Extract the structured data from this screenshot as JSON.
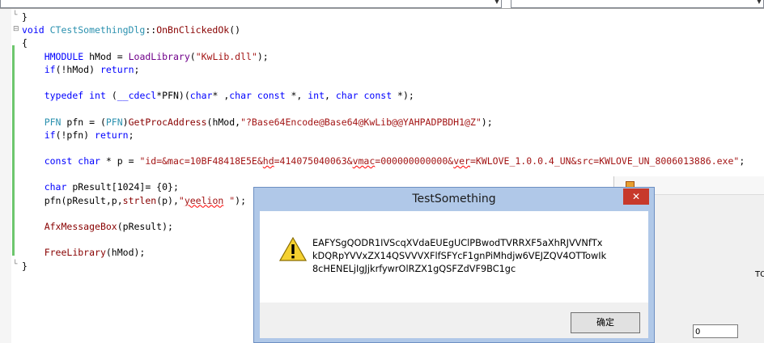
{
  "editor": {
    "lines": [
      {
        "segs": [
          {
            "t": "}",
            "c": ""
          }
        ]
      },
      {
        "segs": [
          {
            "t": "void ",
            "c": "kw"
          },
          {
            "t": "CTestSomethingDlg",
            "c": "cls"
          },
          {
            "t": "::",
            "c": ""
          },
          {
            "t": "OnBnClickedOk",
            "c": "fn"
          },
          {
            "t": "()",
            "c": ""
          }
        ]
      },
      {
        "segs": [
          {
            "t": "{",
            "c": ""
          }
        ]
      },
      {
        "segs": [
          {
            "t": "    ",
            "c": ""
          },
          {
            "t": "HMODULE",
            "c": "ty"
          },
          {
            "t": " ",
            "c": ""
          },
          {
            "t": "hMod",
            "c": ""
          },
          {
            "t": " = ",
            "c": ""
          },
          {
            "t": "LoadLibrary",
            "c": "mac"
          },
          {
            "t": "(",
            "c": ""
          },
          {
            "t": "\"KwLib.dll\"",
            "c": "str"
          },
          {
            "t": ");",
            "c": ""
          }
        ]
      },
      {
        "segs": [
          {
            "t": "    ",
            "c": ""
          },
          {
            "t": "if",
            "c": "kw"
          },
          {
            "t": "(!hMod) ",
            "c": ""
          },
          {
            "t": "return",
            "c": "kw"
          },
          {
            "t": ";",
            "c": ""
          }
        ]
      },
      {
        "segs": [
          {
            "t": "",
            "c": ""
          }
        ]
      },
      {
        "segs": [
          {
            "t": "    ",
            "c": ""
          },
          {
            "t": "typedef",
            "c": "kw"
          },
          {
            "t": " ",
            "c": ""
          },
          {
            "t": "int",
            "c": "kw"
          },
          {
            "t": " (",
            "c": ""
          },
          {
            "t": "__cdecl",
            "c": "kw"
          },
          {
            "t": "*PFN)(",
            "c": ""
          },
          {
            "t": "char",
            "c": "kw"
          },
          {
            "t": "* ,",
            "c": ""
          },
          {
            "t": "char",
            "c": "kw"
          },
          {
            "t": " ",
            "c": ""
          },
          {
            "t": "const",
            "c": "kw"
          },
          {
            "t": " *, ",
            "c": ""
          },
          {
            "t": "int",
            "c": "kw"
          },
          {
            "t": ", ",
            "c": ""
          },
          {
            "t": "char",
            "c": "kw"
          },
          {
            "t": " ",
            "c": ""
          },
          {
            "t": "const",
            "c": "kw"
          },
          {
            "t": " *);",
            "c": ""
          }
        ]
      },
      {
        "segs": [
          {
            "t": "",
            "c": ""
          }
        ]
      },
      {
        "segs": [
          {
            "t": "    ",
            "c": ""
          },
          {
            "t": "PFN",
            "c": "cls"
          },
          {
            "t": " pfn = (",
            "c": ""
          },
          {
            "t": "PFN",
            "c": "cls"
          },
          {
            "t": ")",
            "c": ""
          },
          {
            "t": "GetProcAddress",
            "c": "fn"
          },
          {
            "t": "(hMod,",
            "c": ""
          },
          {
            "t": "\"?Base64Encode@Base64@KwLib@@YAHPADPBDH1@Z\"",
            "c": "str"
          },
          {
            "t": ");",
            "c": ""
          }
        ]
      },
      {
        "segs": [
          {
            "t": "    ",
            "c": ""
          },
          {
            "t": "if",
            "c": "kw"
          },
          {
            "t": "(!pfn) ",
            "c": ""
          },
          {
            "t": "return",
            "c": "kw"
          },
          {
            "t": ";",
            "c": ""
          }
        ]
      },
      {
        "segs": [
          {
            "t": "",
            "c": ""
          }
        ]
      },
      {
        "segs": [
          {
            "t": "    ",
            "c": ""
          },
          {
            "t": "const",
            "c": "kw"
          },
          {
            "t": " ",
            "c": ""
          },
          {
            "t": "char",
            "c": "kw"
          },
          {
            "t": " * p = ",
            "c": ""
          },
          {
            "t": "\"id=&mac=10BF48418E5E&",
            "c": "str"
          },
          {
            "t": "hd",
            "c": "str sq"
          },
          {
            "t": "=414075040063&",
            "c": "str"
          },
          {
            "t": "vmac",
            "c": "str sq"
          },
          {
            "t": "=000000000000&",
            "c": "str"
          },
          {
            "t": "ver",
            "c": "str sq"
          },
          {
            "t": "=KWLOVE_1.0.0.4_UN&src=KWLOVE_UN_8006013886.exe\"",
            "c": "str"
          },
          {
            "t": ";",
            "c": ""
          }
        ]
      },
      {
        "segs": [
          {
            "t": "",
            "c": ""
          }
        ]
      },
      {
        "segs": [
          {
            "t": "    ",
            "c": ""
          },
          {
            "t": "char",
            "c": "kw"
          },
          {
            "t": " pResult[1024]= {0};",
            "c": ""
          }
        ]
      },
      {
        "segs": [
          {
            "t": "    ",
            "c": ""
          },
          {
            "t": "pfn(pResult,p,",
            "c": ""
          },
          {
            "t": "strlen",
            "c": "fn"
          },
          {
            "t": "(p),",
            "c": ""
          },
          {
            "t": "\"",
            "c": "str"
          },
          {
            "t": "yeelion",
            "c": "str sq"
          },
          {
            "t": " \"",
            "c": "str"
          },
          {
            "t": ");",
            "c": ""
          }
        ]
      },
      {
        "segs": [
          {
            "t": "",
            "c": ""
          }
        ]
      },
      {
        "segs": [
          {
            "t": "    ",
            "c": ""
          },
          {
            "t": "AfxMessageBox",
            "c": "fn"
          },
          {
            "t": "(pResult);",
            "c": ""
          }
        ]
      },
      {
        "segs": [
          {
            "t": "",
            "c": ""
          }
        ]
      },
      {
        "segs": [
          {
            "t": "    ",
            "c": ""
          },
          {
            "t": "FreeLibrary",
            "c": "fn"
          },
          {
            "t": "(hMod);",
            "c": ""
          }
        ]
      },
      {
        "segs": [
          {
            "t": "}",
            "c": ""
          }
        ]
      }
    ]
  },
  "background_window": {
    "label": "TO",
    "input_value": "0"
  },
  "dialog": {
    "title": "TestSomething",
    "close_glyph": "✕",
    "message": "EAFYSgQODR1IVScqXVdaEUEgUClPBwodTVRRXF5aXhRJVVNfTx\nkDQRpYVVxZX14QSVVVXFlfSFYcF1gnPiMhdjw6VEJZQV4OTTowIk\n8cHENELjIgJjkrfywrOlRZX1gQSFZdVF9BC1gc",
    "ok_label": "确定"
  }
}
